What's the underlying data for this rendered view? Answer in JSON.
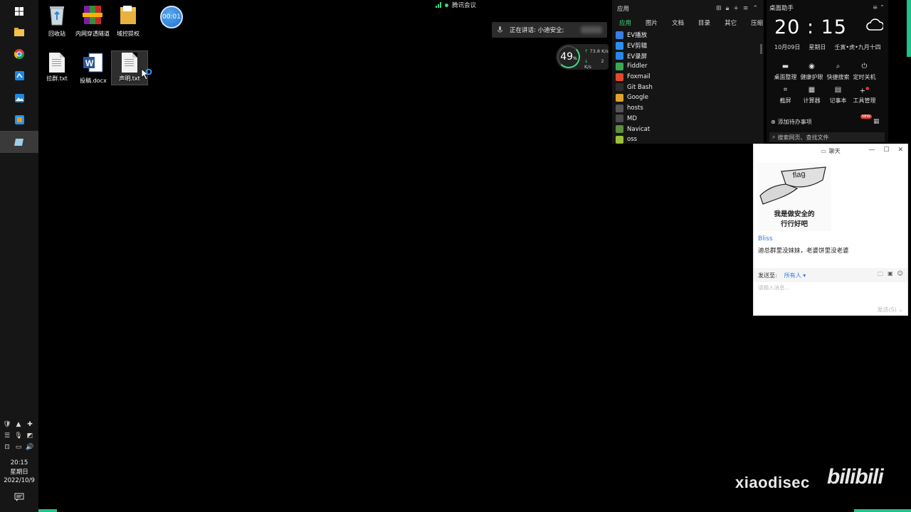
{
  "taskbar": {
    "clock_time": "20:15",
    "clock_day": "星期日",
    "clock_date": "2022/10/9"
  },
  "desktop": {
    "icons_row1": [
      "回收站",
      "内网穿透隧道",
      "域控提权"
    ],
    "icons_row2": [
      "拉群.txt",
      "投稿.docx",
      "声明.txt"
    ],
    "timer": "00:01"
  },
  "meeting": {
    "title": "腾讯会议",
    "speaking": "正在讲话: 小迪安全;"
  },
  "netmon": {
    "percent": "49",
    "unit": "%",
    "up": "73.8",
    "up_unit": "K/s",
    "down": "2",
    "down_unit": "K/s"
  },
  "apps_panel": {
    "title": "应用",
    "tabs": [
      "应用",
      "图片",
      "文档",
      "目录",
      "其它",
      "压缩"
    ],
    "items": [
      {
        "name": "EV播放",
        "color": "#3b7de0"
      },
      {
        "name": "EV剪辑",
        "color": "#2f8ff0"
      },
      {
        "name": "EV录屏",
        "color": "#2a86e8"
      },
      {
        "name": "Fiddler",
        "color": "#3aa757"
      },
      {
        "name": "Foxmail",
        "color": "#e5482d"
      },
      {
        "name": "Git Bash",
        "color": "#2d2d2d"
      },
      {
        "name": "Google",
        "color": "#dfa22a"
      },
      {
        "name": "hosts",
        "color": "#555555"
      },
      {
        "name": "MD",
        "color": "#4a4a4a"
      },
      {
        "name": "Navicat",
        "color": "#5a8f3c"
      },
      {
        "name": "oss",
        "color": "#9bbf3a"
      }
    ]
  },
  "assistant": {
    "title": "桌面助手",
    "time": "20 : 15",
    "date": "10月09日",
    "weekday": "星期日",
    "lunar": "壬寅•虎•九月十四",
    "tools": [
      "桌面整理",
      "健康护眼",
      "快捷搜索",
      "定时关机",
      "截屏",
      "计算器",
      "记事本",
      "工具管理"
    ],
    "todo": "添加待办事项",
    "new_badge": "NEW",
    "search_placeholder": "搜索网页、查找文件"
  },
  "chat": {
    "title": "聊天",
    "sticker_word": "flag",
    "sticker_line1": "我是做安全的",
    "sticker_line2": "行行好吧",
    "sender": "Bliss",
    "message": "迪总群里没妹妹，老婆饼里没老婆",
    "send_to_label": "发送至:",
    "send_to_value": "所有人",
    "input_placeholder": "请输入消息...",
    "send_button": "发送(S)"
  },
  "watermark": {
    "name": "xiaodisec",
    "brand": "bilibili"
  }
}
